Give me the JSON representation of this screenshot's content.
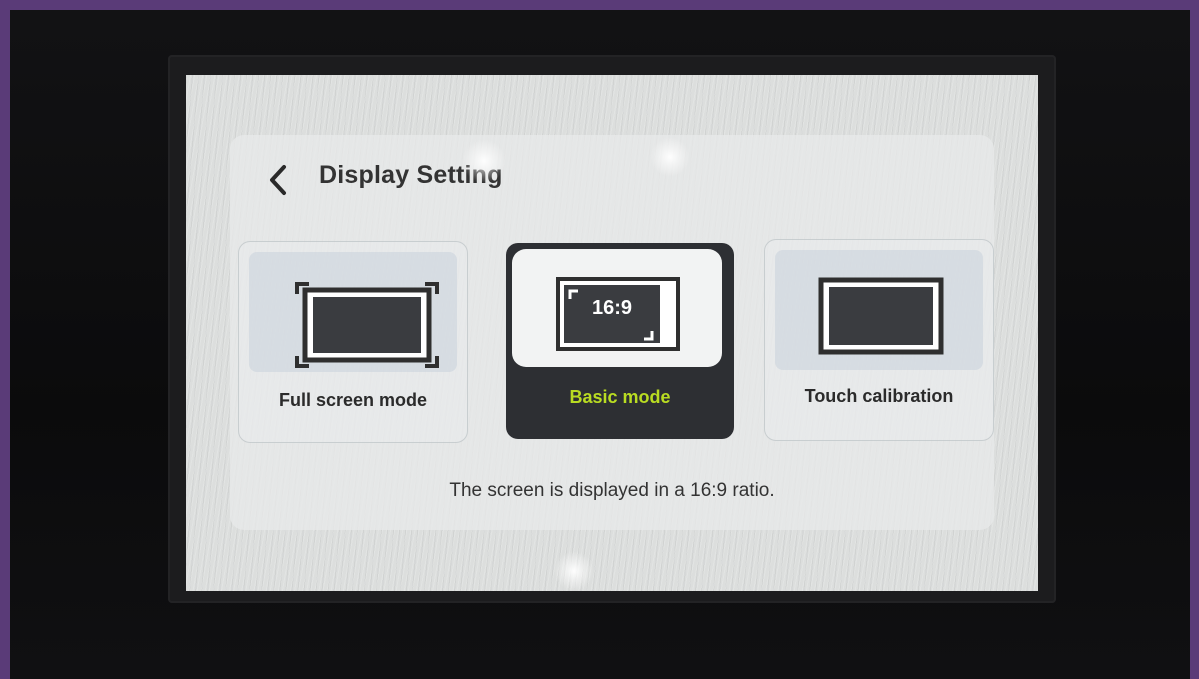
{
  "header": {
    "back_icon": "chevron-left-icon",
    "title": "Display Setting"
  },
  "options": [
    {
      "label": "Full screen mode",
      "icon": "fullscreen-frame-icon",
      "selected": false
    },
    {
      "label": "Basic mode",
      "icon": "ratio-16-9-icon",
      "icon_text": "16:9",
      "selected": true
    },
    {
      "label": "Touch calibration",
      "icon": "touch-calibration-icon",
      "selected": false
    }
  ],
  "description": "The screen is displayed in a 16:9 ratio.",
  "colors": {
    "selected_bg": "#2d2f33",
    "selected_label": "#b9dc22",
    "screen_bg": "#dcdedd",
    "device_border": "#5a3b78"
  }
}
